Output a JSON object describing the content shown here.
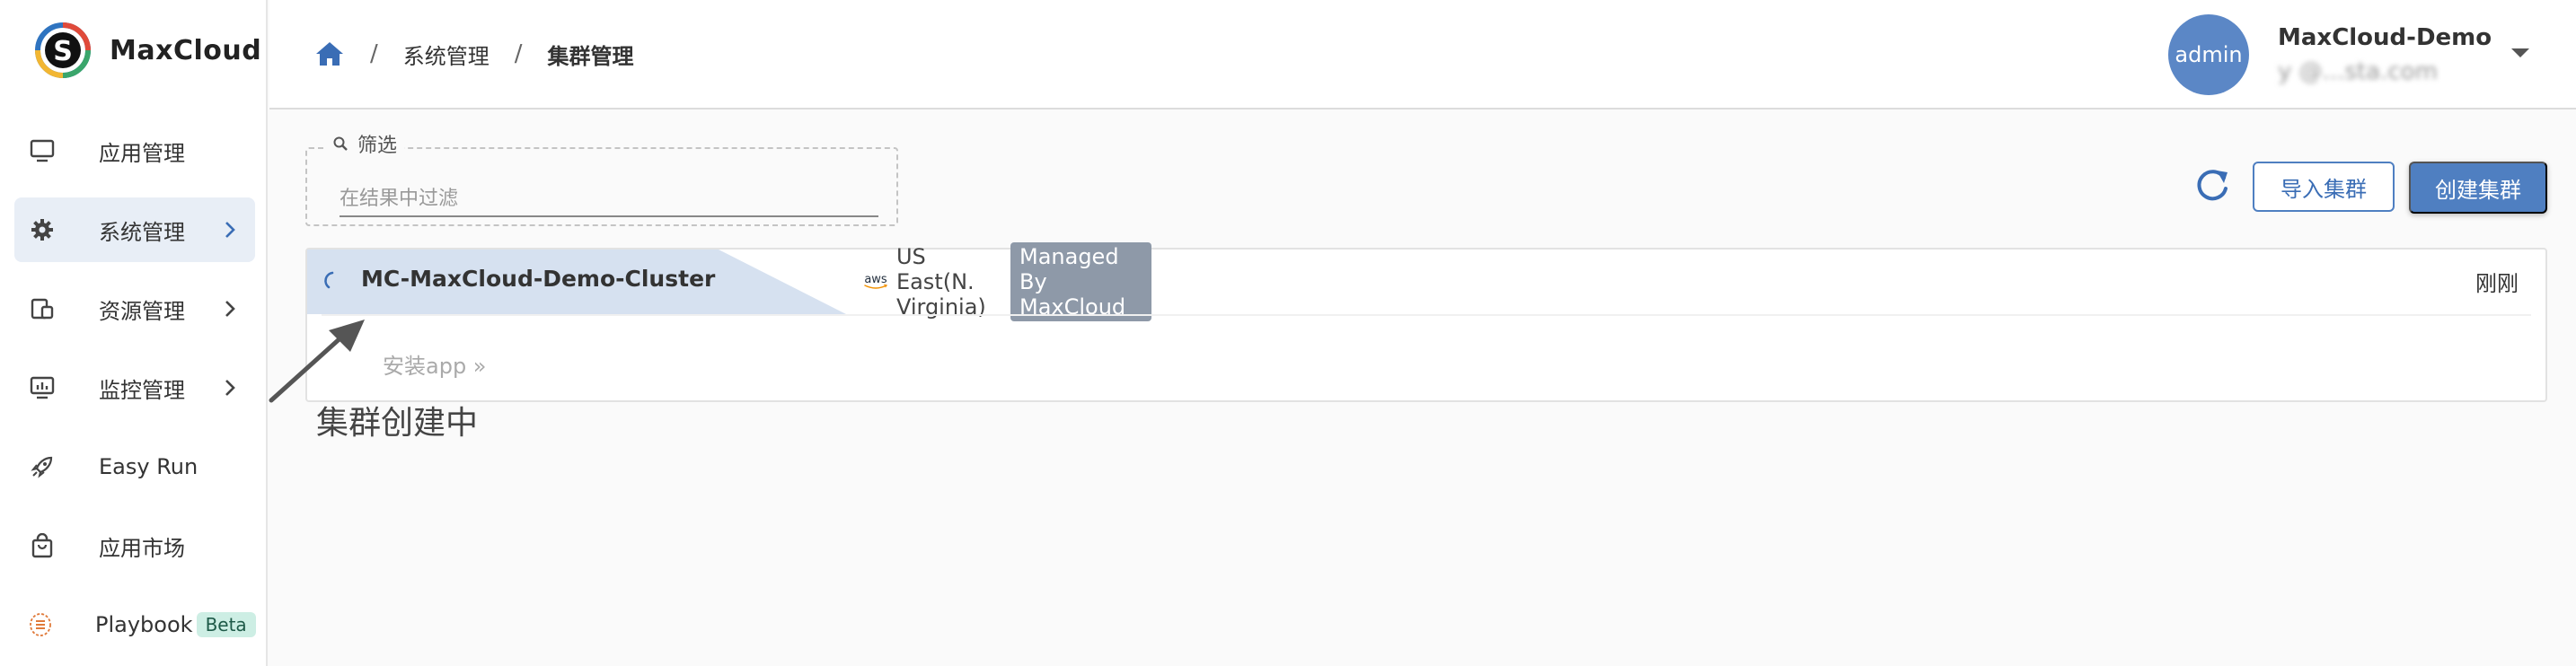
{
  "brand": {
    "name": "MaxCloud"
  },
  "sidebar": {
    "items": [
      {
        "label": "应用管理",
        "icon": "monitor-icon",
        "active": false,
        "has_children": false
      },
      {
        "label": "系统管理",
        "icon": "gear-icon",
        "active": true,
        "has_children": true
      },
      {
        "label": "资源管理",
        "icon": "resources-icon",
        "active": false,
        "has_children": true
      },
      {
        "label": "监控管理",
        "icon": "monitor-chart-icon",
        "active": false,
        "has_children": true
      },
      {
        "label": "Easy Run",
        "icon": "rocket-icon",
        "active": false,
        "has_children": false
      },
      {
        "label": "应用市场",
        "icon": "shopping-bag-icon",
        "active": false,
        "has_children": false
      },
      {
        "label": "Playbook",
        "icon": "playbook-icon",
        "active": false,
        "has_children": false,
        "badge": "Beta"
      }
    ]
  },
  "header": {
    "breadcrumb": [
      "系统管理",
      "集群管理"
    ],
    "user": {
      "avatar_text": "admin",
      "name": "MaxCloud-Demo",
      "email": "y @...sta.com"
    }
  },
  "filter": {
    "legend": "筛选",
    "placeholder": "在结果中过滤"
  },
  "actions": {
    "import_label": "导入集群",
    "create_label": "创建集群"
  },
  "cluster": {
    "name": "MC-MaxCloud-Demo-Cluster",
    "provider_logo": "aws",
    "region": "US East(N. Virginia)",
    "managed_badge": "Managed By MaxCloud",
    "created": "刚刚",
    "install_link": "安装app »",
    "status": "creating"
  },
  "annotation": {
    "text": "集群创建中"
  },
  "colors": {
    "accent": "#4f7fc1",
    "active_bg": "#e8eef6",
    "beta_bg": "#cdeee4"
  }
}
